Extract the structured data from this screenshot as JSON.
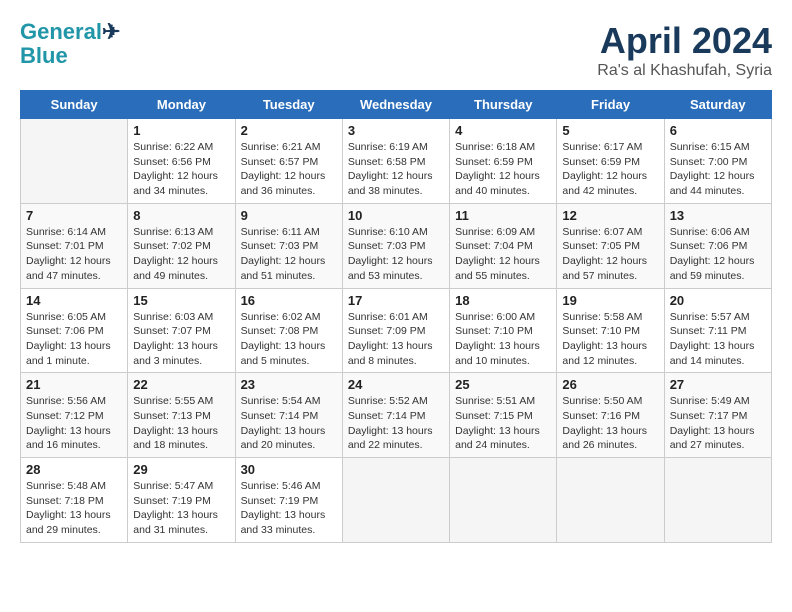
{
  "header": {
    "logo_line1": "General",
    "logo_line2": "Blue",
    "month": "April 2024",
    "location": "Ra's al Khashufah, Syria"
  },
  "weekdays": [
    "Sunday",
    "Monday",
    "Tuesday",
    "Wednesday",
    "Thursday",
    "Friday",
    "Saturday"
  ],
  "weeks": [
    [
      {
        "day": "",
        "info": ""
      },
      {
        "day": "1",
        "info": "Sunrise: 6:22 AM\nSunset: 6:56 PM\nDaylight: 12 hours\nand 34 minutes."
      },
      {
        "day": "2",
        "info": "Sunrise: 6:21 AM\nSunset: 6:57 PM\nDaylight: 12 hours\nand 36 minutes."
      },
      {
        "day": "3",
        "info": "Sunrise: 6:19 AM\nSunset: 6:58 PM\nDaylight: 12 hours\nand 38 minutes."
      },
      {
        "day": "4",
        "info": "Sunrise: 6:18 AM\nSunset: 6:59 PM\nDaylight: 12 hours\nand 40 minutes."
      },
      {
        "day": "5",
        "info": "Sunrise: 6:17 AM\nSunset: 6:59 PM\nDaylight: 12 hours\nand 42 minutes."
      },
      {
        "day": "6",
        "info": "Sunrise: 6:15 AM\nSunset: 7:00 PM\nDaylight: 12 hours\nand 44 minutes."
      }
    ],
    [
      {
        "day": "7",
        "info": "Sunrise: 6:14 AM\nSunset: 7:01 PM\nDaylight: 12 hours\nand 47 minutes."
      },
      {
        "day": "8",
        "info": "Sunrise: 6:13 AM\nSunset: 7:02 PM\nDaylight: 12 hours\nand 49 minutes."
      },
      {
        "day": "9",
        "info": "Sunrise: 6:11 AM\nSunset: 7:03 PM\nDaylight: 12 hours\nand 51 minutes."
      },
      {
        "day": "10",
        "info": "Sunrise: 6:10 AM\nSunset: 7:03 PM\nDaylight: 12 hours\nand 53 minutes."
      },
      {
        "day": "11",
        "info": "Sunrise: 6:09 AM\nSunset: 7:04 PM\nDaylight: 12 hours\nand 55 minutes."
      },
      {
        "day": "12",
        "info": "Sunrise: 6:07 AM\nSunset: 7:05 PM\nDaylight: 12 hours\nand 57 minutes."
      },
      {
        "day": "13",
        "info": "Sunrise: 6:06 AM\nSunset: 7:06 PM\nDaylight: 12 hours\nand 59 minutes."
      }
    ],
    [
      {
        "day": "14",
        "info": "Sunrise: 6:05 AM\nSunset: 7:06 PM\nDaylight: 13 hours\nand 1 minute."
      },
      {
        "day": "15",
        "info": "Sunrise: 6:03 AM\nSunset: 7:07 PM\nDaylight: 13 hours\nand 3 minutes."
      },
      {
        "day": "16",
        "info": "Sunrise: 6:02 AM\nSunset: 7:08 PM\nDaylight: 13 hours\nand 5 minutes."
      },
      {
        "day": "17",
        "info": "Sunrise: 6:01 AM\nSunset: 7:09 PM\nDaylight: 13 hours\nand 8 minutes."
      },
      {
        "day": "18",
        "info": "Sunrise: 6:00 AM\nSunset: 7:10 PM\nDaylight: 13 hours\nand 10 minutes."
      },
      {
        "day": "19",
        "info": "Sunrise: 5:58 AM\nSunset: 7:10 PM\nDaylight: 13 hours\nand 12 minutes."
      },
      {
        "day": "20",
        "info": "Sunrise: 5:57 AM\nSunset: 7:11 PM\nDaylight: 13 hours\nand 14 minutes."
      }
    ],
    [
      {
        "day": "21",
        "info": "Sunrise: 5:56 AM\nSunset: 7:12 PM\nDaylight: 13 hours\nand 16 minutes."
      },
      {
        "day": "22",
        "info": "Sunrise: 5:55 AM\nSunset: 7:13 PM\nDaylight: 13 hours\nand 18 minutes."
      },
      {
        "day": "23",
        "info": "Sunrise: 5:54 AM\nSunset: 7:14 PM\nDaylight: 13 hours\nand 20 minutes."
      },
      {
        "day": "24",
        "info": "Sunrise: 5:52 AM\nSunset: 7:14 PM\nDaylight: 13 hours\nand 22 minutes."
      },
      {
        "day": "25",
        "info": "Sunrise: 5:51 AM\nSunset: 7:15 PM\nDaylight: 13 hours\nand 24 minutes."
      },
      {
        "day": "26",
        "info": "Sunrise: 5:50 AM\nSunset: 7:16 PM\nDaylight: 13 hours\nand 26 minutes."
      },
      {
        "day": "27",
        "info": "Sunrise: 5:49 AM\nSunset: 7:17 PM\nDaylight: 13 hours\nand 27 minutes."
      }
    ],
    [
      {
        "day": "28",
        "info": "Sunrise: 5:48 AM\nSunset: 7:18 PM\nDaylight: 13 hours\nand 29 minutes."
      },
      {
        "day": "29",
        "info": "Sunrise: 5:47 AM\nSunset: 7:19 PM\nDaylight: 13 hours\nand 31 minutes."
      },
      {
        "day": "30",
        "info": "Sunrise: 5:46 AM\nSunset: 7:19 PM\nDaylight: 13 hours\nand 33 minutes."
      },
      {
        "day": "",
        "info": ""
      },
      {
        "day": "",
        "info": ""
      },
      {
        "day": "",
        "info": ""
      },
      {
        "day": "",
        "info": ""
      }
    ]
  ]
}
